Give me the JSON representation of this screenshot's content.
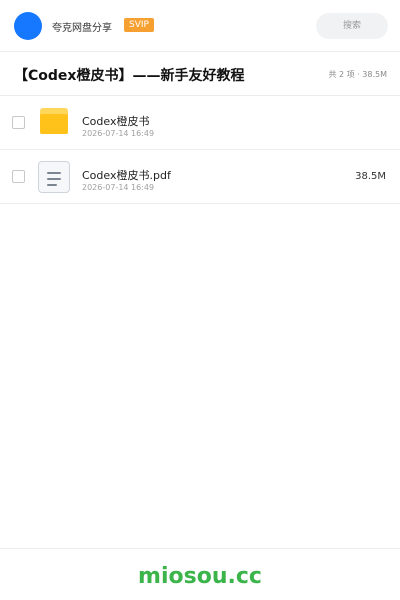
{
  "header": {
    "username": "夸克网盘分享",
    "vip_badge": "SVIP",
    "search_placeholder": "搜索",
    "accent_color": "#1677ff",
    "vip_color": "#f7a032"
  },
  "share": {
    "title": "【Codex橙皮书】——新手友好教程",
    "summary": "共 2 项 · 38.5M"
  },
  "files": [
    {
      "icon": "folder-icon",
      "name": "Codex橙皮书",
      "date": "2026-07-14 16:49",
      "size": ""
    },
    {
      "icon": "document-icon",
      "name": "Codex橙皮书.pdf",
      "date": "2026-07-14 16:49",
      "size": "38.5M"
    }
  ],
  "footer": {
    "brand": "miosou.cc",
    "brand_color": "#3bb44a"
  }
}
